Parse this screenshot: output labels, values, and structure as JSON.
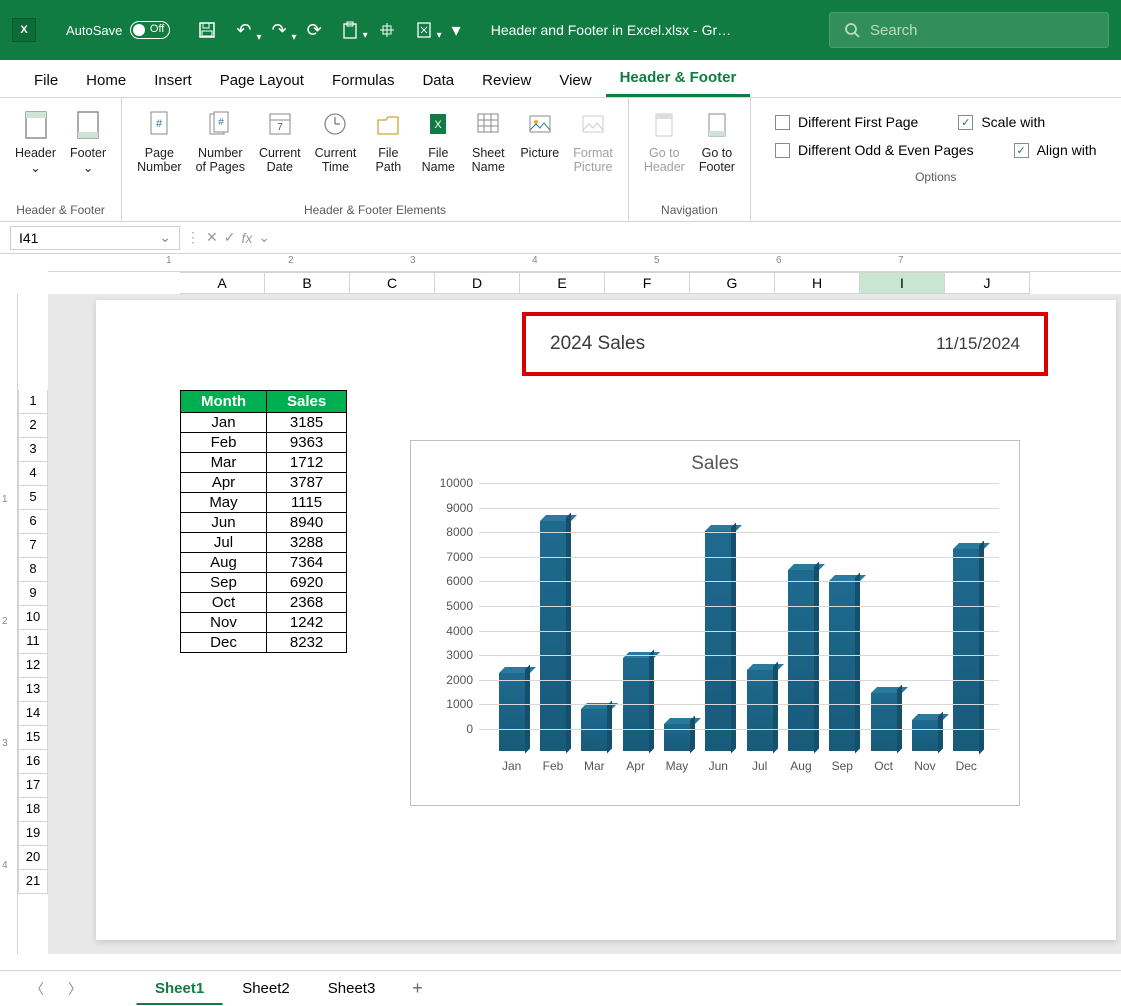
{
  "titlebar": {
    "autosave_label": "AutoSave",
    "autosave_state": "Off",
    "file_title": "Header and Footer in Excel.xlsx  -  Gr…",
    "search_placeholder": "Search"
  },
  "tabs": [
    "File",
    "Home",
    "Insert",
    "Page Layout",
    "Formulas",
    "Data",
    "Review",
    "View",
    "Header & Footer"
  ],
  "active_tab": "Header & Footer",
  "ribbon": {
    "group_hf": {
      "label": "Header & Footer",
      "header": "Header",
      "footer": "Footer"
    },
    "group_elements": {
      "label": "Header & Footer Elements",
      "page_number": "Page\nNumber",
      "num_pages": "Number\nof Pages",
      "cur_date": "Current\nDate",
      "cur_time": "Current\nTime",
      "file_path": "File\nPath",
      "file_name": "File\nName",
      "sheet_name": "Sheet\nName",
      "picture": "Picture",
      "fmt_picture": "Format\nPicture"
    },
    "group_nav": {
      "label": "Navigation",
      "goto_header": "Go to\nHeader",
      "goto_footer": "Go to\nFooter"
    },
    "group_opts": {
      "label": "Options",
      "diff_first": "Different First Page",
      "diff_oddeven": "Different Odd & Even Pages",
      "scale": "Scale with",
      "align": "Align with"
    }
  },
  "namebox": "I41",
  "columns": [
    "A",
    "B",
    "C",
    "D",
    "E",
    "F",
    "G",
    "H",
    "I",
    "J"
  ],
  "selected_col_idx": 8,
  "rows": [
    1,
    2,
    3,
    4,
    5,
    6,
    7,
    8,
    9,
    10,
    11,
    12,
    13,
    14,
    15,
    16,
    17,
    18,
    19,
    20,
    21
  ],
  "header_highlight": {
    "title": "2024 Sales",
    "date": "11/15/2024"
  },
  "table": {
    "headers": [
      "Month",
      "Sales"
    ],
    "rows": [
      [
        "Jan",
        "3185"
      ],
      [
        "Feb",
        "9363"
      ],
      [
        "Mar",
        "1712"
      ],
      [
        "Apr",
        "3787"
      ],
      [
        "May",
        "1115"
      ],
      [
        "Jun",
        "8940"
      ],
      [
        "Jul",
        "3288"
      ],
      [
        "Aug",
        "7364"
      ],
      [
        "Sep",
        "6920"
      ],
      [
        "Oct",
        "2368"
      ],
      [
        "Nov",
        "1242"
      ],
      [
        "Dec",
        "8232"
      ]
    ]
  },
  "chart_data": {
    "type": "bar",
    "title": "Sales",
    "categories": [
      "Jan",
      "Feb",
      "Mar",
      "Apr",
      "May",
      "Jun",
      "Jul",
      "Aug",
      "Sep",
      "Oct",
      "Nov",
      "Dec"
    ],
    "values": [
      3185,
      9363,
      1712,
      3787,
      1115,
      8940,
      3288,
      7364,
      6920,
      2368,
      1242,
      8232
    ],
    "ylim": [
      0,
      10000
    ],
    "yticks": [
      0,
      1000,
      2000,
      3000,
      4000,
      5000,
      6000,
      7000,
      8000,
      9000,
      10000
    ],
    "xlabel": "",
    "ylabel": ""
  },
  "sheet_tabs": [
    "Sheet1",
    "Sheet2",
    "Sheet3"
  ],
  "active_sheet": "Sheet1",
  "ruler_h": [
    1,
    2,
    3,
    4,
    5,
    6,
    7
  ],
  "ruler_v": [
    1,
    2,
    3,
    4
  ]
}
